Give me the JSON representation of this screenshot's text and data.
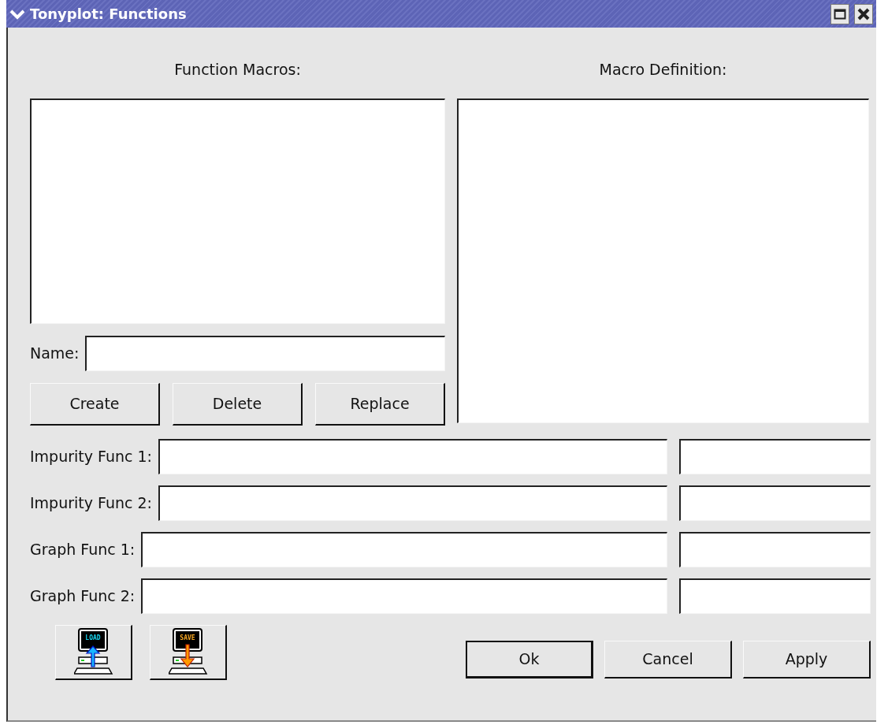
{
  "window": {
    "title": "Tonyplot: Functions"
  },
  "macros": {
    "label": "Function Macros:"
  },
  "definition": {
    "label": "Macro Definition:"
  },
  "name_field": {
    "label": "Name:"
  },
  "macro_buttons": [
    {
      "label": "Create"
    },
    {
      "label": "Delete"
    },
    {
      "label": "Replace"
    }
  ],
  "function_rows": [
    {
      "label": "Impurity Func 1:"
    },
    {
      "label": "Impurity Func 2:"
    },
    {
      "label": "Graph Func 1:"
    },
    {
      "label": "Graph Func 2:"
    }
  ],
  "file_buttons": [
    {
      "kind": "load",
      "text": "LOAD"
    },
    {
      "kind": "save",
      "text": "SAVE"
    }
  ],
  "dialog_buttons": [
    {
      "label": "Ok",
      "default": true
    },
    {
      "label": "Cancel",
      "default": false
    },
    {
      "label": "Apply",
      "default": false
    }
  ]
}
